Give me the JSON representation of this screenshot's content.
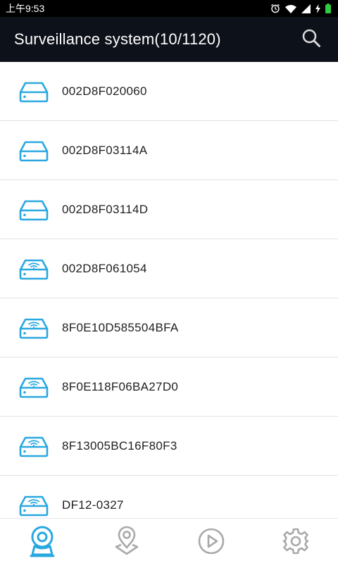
{
  "status_bar": {
    "time": "上午9:53",
    "icons": [
      "alarm-icon",
      "wifi-icon",
      "signal-icon",
      "charging-icon",
      "battery-icon"
    ]
  },
  "header": {
    "title": "Surveillance system(10/1120)",
    "search_icon": "search-icon"
  },
  "devices": [
    {
      "name": "002D8F020060",
      "type": "wired"
    },
    {
      "name": "002D8F03114A",
      "type": "wired"
    },
    {
      "name": "002D8F03114D",
      "type": "wired"
    },
    {
      "name": "002D8F061054",
      "type": "wifi"
    },
    {
      "name": "8F0E10D585504BFA",
      "type": "wifi"
    },
    {
      "name": "8F0E118F06BA27D0",
      "type": "wifi"
    },
    {
      "name": "8F13005BC16F80F3",
      "type": "wifi"
    },
    {
      "name": "DF12-0327",
      "type": "wifi"
    }
  ],
  "bottom_nav": {
    "items": [
      {
        "icon": "camera-user-icon",
        "active": true
      },
      {
        "icon": "map-pin-icon",
        "active": false
      },
      {
        "icon": "play-icon",
        "active": false
      },
      {
        "icon": "gear-icon",
        "active": false
      }
    ]
  },
  "colors": {
    "accent": "#29a8e0",
    "header_bg": "#0d1119",
    "inactive_icon": "#a9a9a9",
    "battery": "#2ecc40"
  }
}
